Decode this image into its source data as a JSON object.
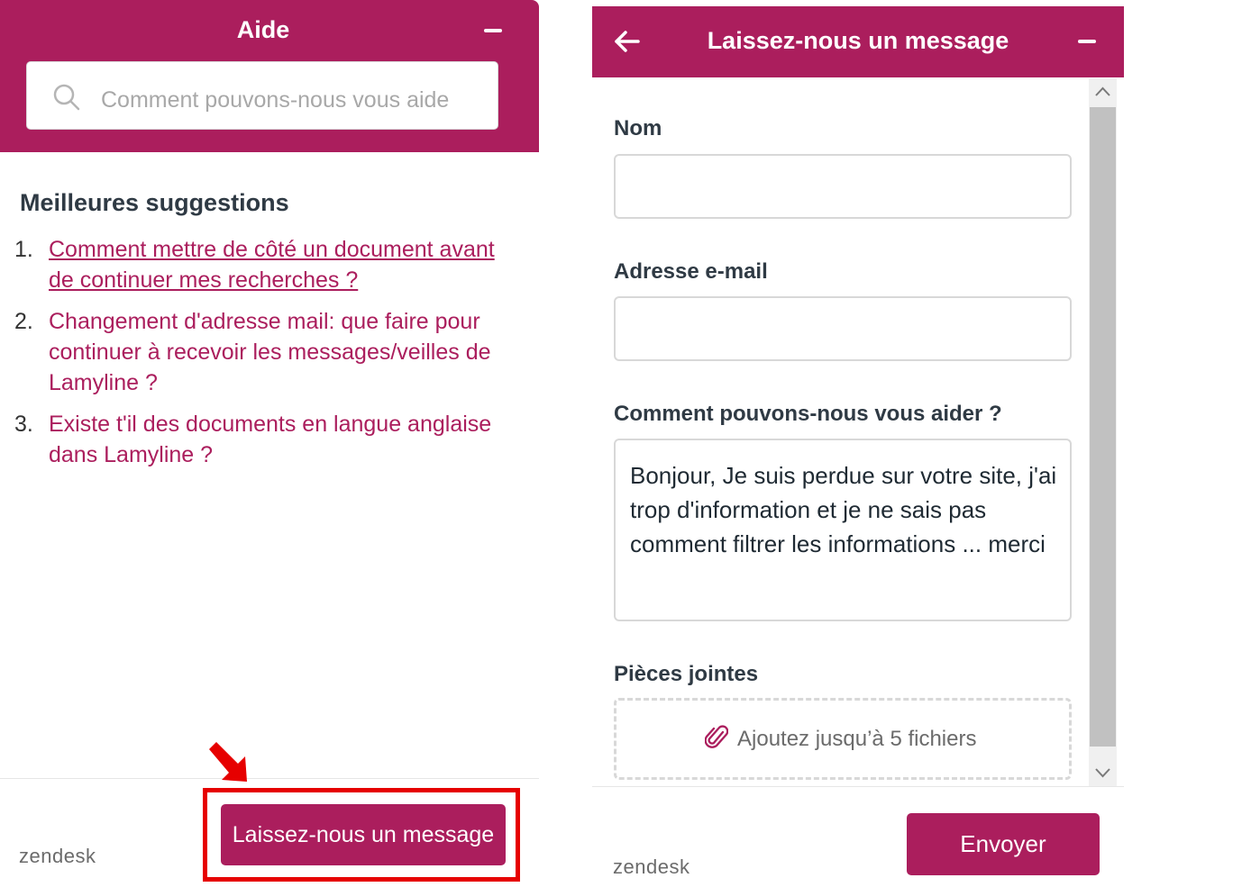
{
  "help_widget": {
    "title": "Aide",
    "search_placeholder": "Comment pouvons-nous vous aider ?",
    "suggestions_title": "Meilleures suggestions",
    "suggestions": [
      {
        "num": "1.",
        "text": "Comment mettre de côté un document avant de continuer mes recherches ?"
      },
      {
        "num": "2.",
        "text": "Changement d'adresse mail: que faire pour continuer à recevoir les messages/veilles de Lamyline ?"
      },
      {
        "num": "3.",
        "text": "Existe t'il des documents en langue anglaise dans Lamyline ?"
      }
    ],
    "leave_message_button": "Laissez-nous un message",
    "brand": "zendesk"
  },
  "message_form": {
    "title": "Laissez-nous un message",
    "name_label": "Nom",
    "name_value": "",
    "email_label": "Adresse e-mail",
    "email_value": "",
    "help_label": "Comment pouvons-nous vous aider ?",
    "help_value": "Bonjour, Je suis perdue sur votre site, j'ai trop d'information et je ne sais pas comment filtrer les informations ... merci",
    "attachments_label": "Pièces jointes",
    "attachments_hint": "Ajoutez jusqu’à 5 fichiers",
    "send_button": "Envoyer",
    "brand": "zendesk"
  },
  "colors": {
    "brand": "#ab1e5d",
    "highlight": "#e60000"
  },
  "icons": [
    "search-icon",
    "minimize-icon",
    "back-arrow-icon",
    "paperclip-icon",
    "chevron-up-icon",
    "chevron-down-icon",
    "red-arrow-icon"
  ]
}
